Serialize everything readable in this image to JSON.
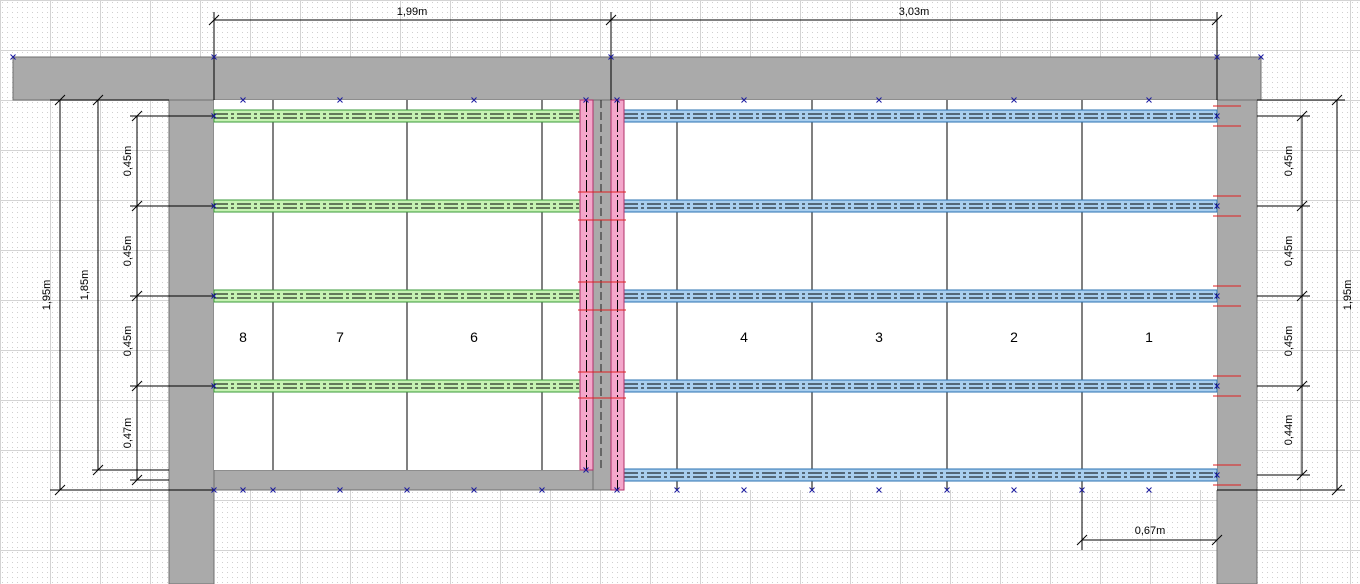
{
  "colors": {
    "wall": "#aaaaaa",
    "wall_stroke": "#707070",
    "beam_left": "#c6f2b3",
    "beam_right": "#a9cfef",
    "beam_center": "#f4a7cb",
    "cut_mark": "#e02020",
    "node": "#1a1aa0"
  },
  "dimensions": {
    "top_left": "1,99m",
    "top_right": "3,03m",
    "left_outer": "1,95m",
    "left_inner": "1,85m",
    "left_spans": [
      "0,45m",
      "0,45m",
      "0,45m",
      "0,47m"
    ],
    "right_spans": [
      "0,45m",
      "0,45m",
      "0,45m",
      "0,44m"
    ],
    "right_outer": "1,95m",
    "bottom": "0,67m"
  },
  "areas": [
    "8",
    "7",
    "6",
    "4",
    "3",
    "2",
    "1"
  ]
}
